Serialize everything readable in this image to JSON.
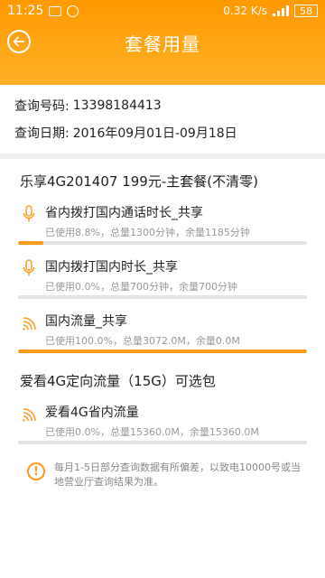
{
  "statusbar": {
    "time": "11:25",
    "net_speed": "0.32",
    "net_unit": "K/s",
    "battery": "58"
  },
  "nav": {
    "title": "套餐用量"
  },
  "info": {
    "number_label": "查询号码:",
    "number_value": "13398184413",
    "date_label": "查询日期:",
    "date_value": "2016年09月01日-09月18日"
  },
  "sections": [
    {
      "title": "乐享4G201407 199元-主套餐(不清零)",
      "items": [
        {
          "name": "省内拨打国内通话时长_共享",
          "detail": "已使用8.8%，总量1300分钟，余量1185分钟",
          "icon": "microphone-icon",
          "percent": 8.8
        },
        {
          "name": "国内拨打国内时长_共享",
          "detail": "已使用0.0%，总量700分钟，余量700分钟",
          "icon": "microphone-icon",
          "percent": 0.0
        },
        {
          "name": "国内流量_共享",
          "detail": "已使用100.0%，总量3072.0M，余量0.0M",
          "icon": "wifi-signal-icon",
          "percent": 100.0
        }
      ]
    },
    {
      "title": "爱看4G定向流量（15G）可选包",
      "items": [
        {
          "name": "爱看4G省内流量",
          "detail": "已使用0.0%，总量15360.0M，余量15360.0M",
          "icon": "wifi-signal-icon",
          "percent": 0.0
        }
      ]
    }
  ],
  "notice": {
    "text": "每月1-5日部分查询数据有所偏差，以致电10000号或当地营业厅查询结果为准。"
  },
  "colors": {
    "accent": "#ff9a1e",
    "header": "#ffa511"
  }
}
